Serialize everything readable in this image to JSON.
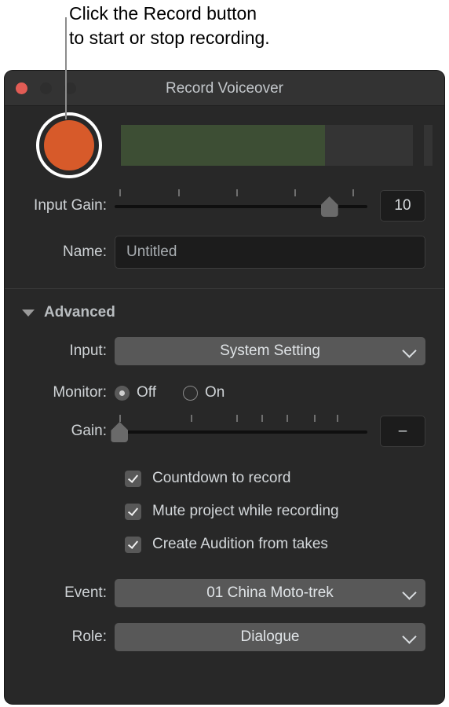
{
  "callout": {
    "text": "Click the Record button\nto start or stop recording."
  },
  "window": {
    "title": "Record Voiceover",
    "traffic_lights": {
      "close": "close-button",
      "minimize": "minimize-button",
      "maximize": "maximize-button"
    },
    "colors": {
      "close": "#e25c55",
      "inactive": "#2e2e2e",
      "record_orange": "#d75a2a",
      "meter_green": "#3d4e34",
      "panel_bg": "#282828",
      "titlebar_bg": "#333333"
    }
  },
  "record": {
    "button_name": "Record",
    "meter_level_percent": 70,
    "meter_name": "input-level-meter"
  },
  "input_gain": {
    "label": "Input Gain:",
    "value": "10",
    "thumb_percent": 85,
    "ticks_percent": [
      2,
      25,
      48,
      71,
      94
    ]
  },
  "name": {
    "label": "Name:",
    "value": "Untitled",
    "placeholder": "Untitled"
  },
  "advanced": {
    "label": "Advanced",
    "expanded": true,
    "input": {
      "label": "Input:",
      "value": "System Setting"
    },
    "monitor": {
      "label": "Monitor:",
      "options": [
        {
          "label": "Off",
          "selected": true
        },
        {
          "label": "On",
          "selected": false
        }
      ]
    },
    "gain": {
      "label": "Gain:",
      "value": "–",
      "thumb_percent": 2,
      "ticks_percent": [
        2,
        30,
        48,
        58,
        68,
        79,
        88
      ]
    },
    "checkboxes": [
      {
        "label": "Countdown to record",
        "checked": true
      },
      {
        "label": "Mute project while recording",
        "checked": true
      },
      {
        "label": "Create Audition from takes",
        "checked": true
      }
    ],
    "event": {
      "label": "Event:",
      "value": "01 China Moto-trek"
    },
    "role": {
      "label": "Role:",
      "value": "Dialogue"
    }
  }
}
